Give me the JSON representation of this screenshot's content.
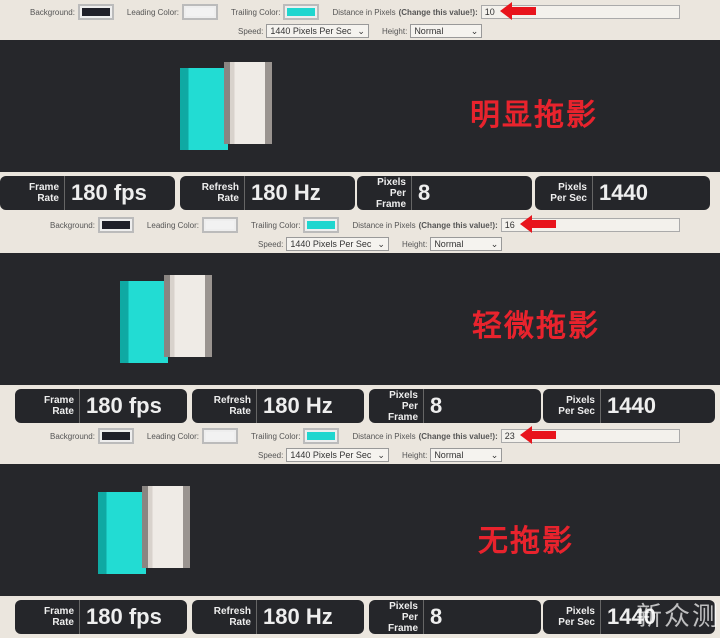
{
  "colors": {
    "background": "#1f2029",
    "leading": "#f2f2f2",
    "trailing": "#1fd6cf",
    "label": "#e8232d"
  },
  "control_labels": {
    "background": "Background:",
    "leading": "Leading Color:",
    "trailing": "Trailing Color:",
    "distance": "Distance in Pixels",
    "distance_hint": "(Change this value!):",
    "speed": "Speed:",
    "height": "Height:"
  },
  "stat_labels": {
    "frame_rate": "Frame Rate",
    "refresh_rate": "Refresh Rate",
    "pixels_per_frame": "Pixels Per Frame",
    "pixels_per_sec": "Pixels Per Sec"
  },
  "panels": [
    {
      "distance": "10",
      "speed": "1440 Pixels Per Sec",
      "height": "Normal",
      "label": "明显拖影",
      "frame_rate": "180 fps",
      "refresh_rate": "180 Hz",
      "pixels_per_frame": "8",
      "pixels_per_sec": "1440"
    },
    {
      "distance": "16",
      "speed": "1440 Pixels Per Sec",
      "height": "Normal",
      "label": "轻微拖影",
      "frame_rate": "180 fps",
      "refresh_rate": "180 Hz",
      "pixels_per_frame": "8",
      "pixels_per_sec": "1440"
    },
    {
      "distance": "23",
      "speed": "1440 Pixels Per Sec",
      "height": "Normal",
      "label": "无拖影",
      "frame_rate": "180 fps",
      "refresh_rate": "180 Hz",
      "pixels_per_frame": "8",
      "pixels_per_sec": "1440"
    }
  ],
  "watermark": "新众测"
}
